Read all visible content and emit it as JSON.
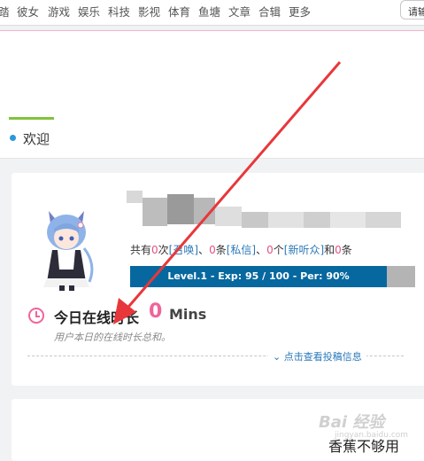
{
  "nav": {
    "items": [
      "踏",
      "彼女",
      "游戏",
      "娱乐",
      "科技",
      "影视",
      "体育",
      "鱼塘",
      "文章",
      "合辑",
      "更多"
    ],
    "right_button": "请输"
  },
  "welcome": {
    "label": "欢迎"
  },
  "user": {
    "stats": {
      "p1": "共有",
      "n1": "0",
      "p2": "次",
      "l1": "[召唤]",
      "p3": "、",
      "n2": "0",
      "p4": "条",
      "l2": "[私信]",
      "p5": "、",
      "n3": "0",
      "p6": "个",
      "l3": "[新听众]",
      "p7": "和",
      "n4": "0",
      "p8": "条"
    },
    "level_text": "Level.1 - Exp: 95 / 100 - Per: 90%",
    "level_fraction": 0.9
  },
  "online": {
    "title": "今日在线时长",
    "value": "0",
    "unit": "Mins",
    "desc": "用户本日的在线时长总和。"
  },
  "view_more": "点击查看投稿信息",
  "card2_text": "香蕉不够用",
  "watermark": "Bai 经验",
  "watermark_sub": "jingyan.baidu.com",
  "colors": {
    "accent_pink": "#f0639a",
    "level_blue": "#07689f",
    "link_blue": "#2a79b8",
    "arrow_red": "#e8373a"
  }
}
